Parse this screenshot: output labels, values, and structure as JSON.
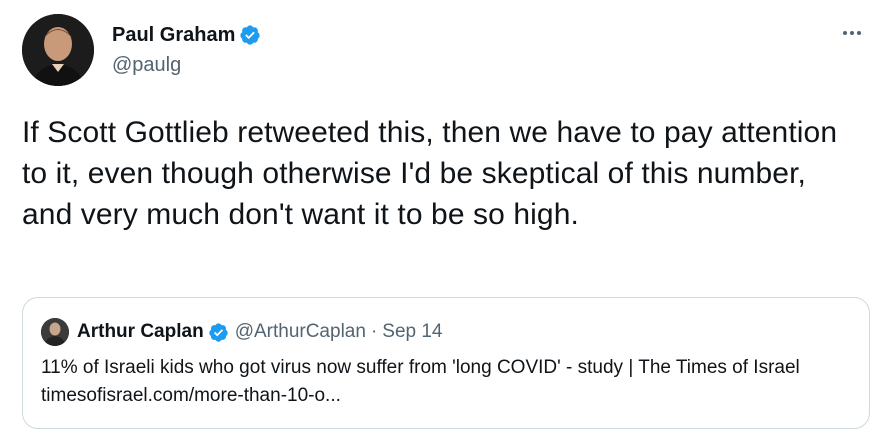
{
  "author": {
    "name": "Paul Graham",
    "handle": "@paulg",
    "verified_icon": "verified-badge-icon"
  },
  "more_icon": "more-horizontal-icon",
  "tweet": {
    "text": "If Scott Gottlieb retweeted this, then we have to pay attention to it, even though otherwise I'd be skeptical of this number, and very much don't want it to be so high."
  },
  "quoted": {
    "name": "Arthur Caplan",
    "handle": "@ArthurCaplan",
    "separator": "·",
    "date": "Sep 14",
    "text": "11% of Israeli kids who got virus now suffer from 'long COVID' - study | The Times of Israel timesofisrael.com/more-than-10-o..."
  },
  "colors": {
    "text_primary": "#0f1419",
    "text_secondary": "#536471",
    "verified_blue": "#1d9bf0",
    "border": "#cfd9de"
  }
}
